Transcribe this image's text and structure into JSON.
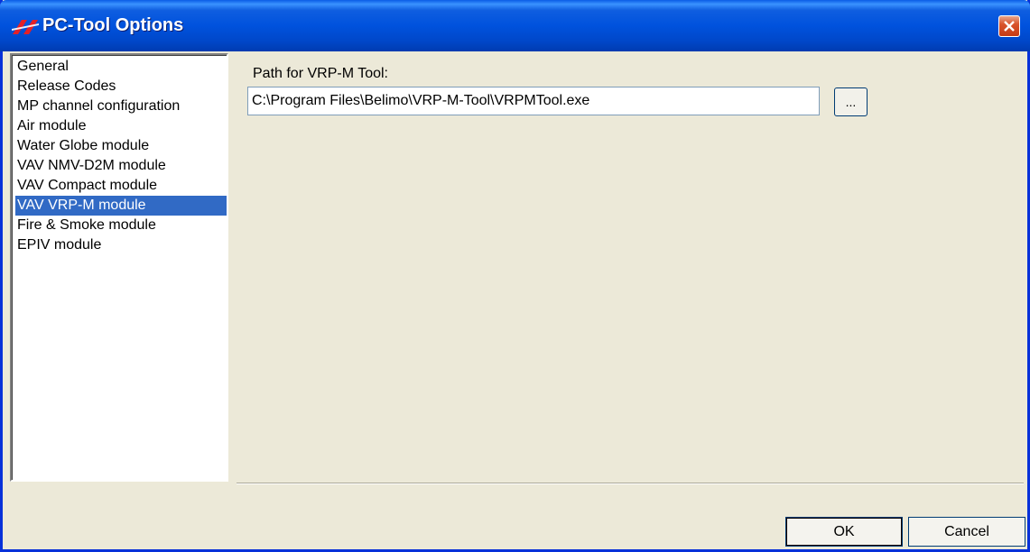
{
  "window": {
    "title": "PC-Tool Options",
    "title_bar_color": "#0052dd",
    "logo_color": "#e32127"
  },
  "categories": {
    "items": [
      {
        "label": "General"
      },
      {
        "label": "Release Codes"
      },
      {
        "label": "MP channel configuration"
      },
      {
        "label": "Air module"
      },
      {
        "label": "Water Globe module"
      },
      {
        "label": "VAV NMV-D2M module"
      },
      {
        "label": "VAV Compact module"
      },
      {
        "label": "VAV VRP-M module"
      },
      {
        "label": "Fire & Smoke module"
      },
      {
        "label": "EPIV module"
      }
    ],
    "selected": "VAV VRP-M module",
    "selection_color": "#316ac5"
  },
  "settings": {
    "path_label": "Path for VRP-M Tool:",
    "path_value": "C:\\Program Files\\Belimo\\VRP-M-Tool\\VRPMTool.exe",
    "browse_label": "..."
  },
  "buttons": {
    "ok_label": "OK",
    "cancel_label": "Cancel"
  },
  "icons": {
    "logo": "belimo-logo-icon",
    "close": "close-icon"
  }
}
